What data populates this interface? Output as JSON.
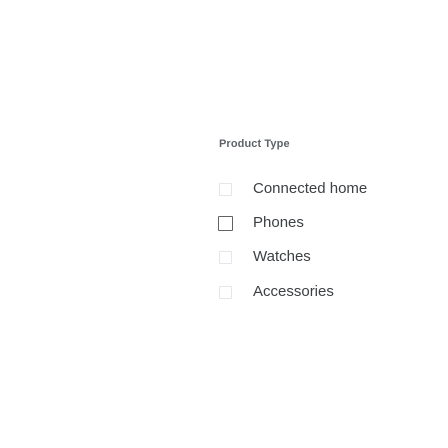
{
  "filter": {
    "title": "Product Type",
    "options": [
      {
        "label": "Connected home",
        "checked": false
      },
      {
        "label": "Phones",
        "checked": false
      },
      {
        "label": "Watches",
        "checked": false
      },
      {
        "label": "Accessories",
        "checked": false
      }
    ]
  }
}
